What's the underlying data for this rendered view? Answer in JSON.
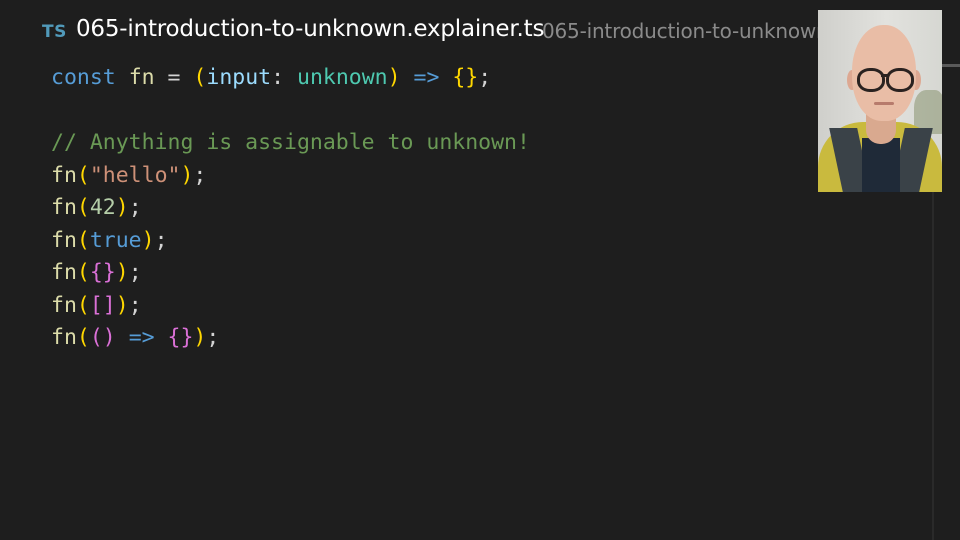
{
  "editor": {
    "tab": {
      "language_badge": "TS",
      "title": "065-introduction-to-unknown.explainer.ts",
      "path": "065-introduction-to-unknown.explainer.ts"
    },
    "code_lines": [
      [
        {
          "t": "const",
          "c": "kw"
        },
        {
          "t": " ",
          "c": "op"
        },
        {
          "t": "fn",
          "c": "def"
        },
        {
          "t": " = ",
          "c": "op"
        },
        {
          "t": "(",
          "c": "b1"
        },
        {
          "t": "input",
          "c": "param"
        },
        {
          "t": ": ",
          "c": "op"
        },
        {
          "t": "unknown",
          "c": "type"
        },
        {
          "t": ")",
          "c": "b1"
        },
        {
          "t": " ",
          "c": "op"
        },
        {
          "t": "=>",
          "c": "arrow"
        },
        {
          "t": " ",
          "c": "op"
        },
        {
          "t": "{}",
          "c": "b1"
        },
        {
          "t": ";",
          "c": "punc"
        }
      ],
      [],
      [
        {
          "t": "// Anything is assignable to unknown!",
          "c": "comment"
        }
      ],
      [
        {
          "t": "fn",
          "c": "def"
        },
        {
          "t": "(",
          "c": "b1"
        },
        {
          "t": "\"hello\"",
          "c": "str"
        },
        {
          "t": ")",
          "c": "b1"
        },
        {
          "t": ";",
          "c": "punc"
        }
      ],
      [
        {
          "t": "fn",
          "c": "def"
        },
        {
          "t": "(",
          "c": "b1"
        },
        {
          "t": "42",
          "c": "num"
        },
        {
          "t": ")",
          "c": "b1"
        },
        {
          "t": ";",
          "c": "punc"
        }
      ],
      [
        {
          "t": "fn",
          "c": "def"
        },
        {
          "t": "(",
          "c": "b1"
        },
        {
          "t": "true",
          "c": "kw"
        },
        {
          "t": ")",
          "c": "b1"
        },
        {
          "t": ";",
          "c": "punc"
        }
      ],
      [
        {
          "t": "fn",
          "c": "def"
        },
        {
          "t": "(",
          "c": "b1"
        },
        {
          "t": "{}",
          "c": "b2"
        },
        {
          "t": ")",
          "c": "b1"
        },
        {
          "t": ";",
          "c": "punc"
        }
      ],
      [
        {
          "t": "fn",
          "c": "def"
        },
        {
          "t": "(",
          "c": "b1"
        },
        {
          "t": "[]",
          "c": "b2"
        },
        {
          "t": ")",
          "c": "b1"
        },
        {
          "t": ";",
          "c": "punc"
        }
      ],
      [
        {
          "t": "fn",
          "c": "def"
        },
        {
          "t": "(",
          "c": "b1"
        },
        {
          "t": "()",
          "c": "b2"
        },
        {
          "t": " ",
          "c": "op"
        },
        {
          "t": "=>",
          "c": "arrow"
        },
        {
          "t": " ",
          "c": "op"
        },
        {
          "t": "{}",
          "c": "b2"
        },
        {
          "t": ")",
          "c": "b1"
        },
        {
          "t": ";",
          "c": "punc"
        }
      ]
    ],
    "colors": {
      "background": "#1e1e1e",
      "keyword": "#569cd6",
      "function": "#dcdcaa",
      "string": "#ce9178",
      "number": "#b5cea8",
      "comment": "#6a9955",
      "type": "#4ec9b0",
      "bracket_level_1": "#ffd700",
      "bracket_level_2": "#da70d6"
    }
  },
  "webcam": {
    "icon": "presenter-webcam"
  }
}
